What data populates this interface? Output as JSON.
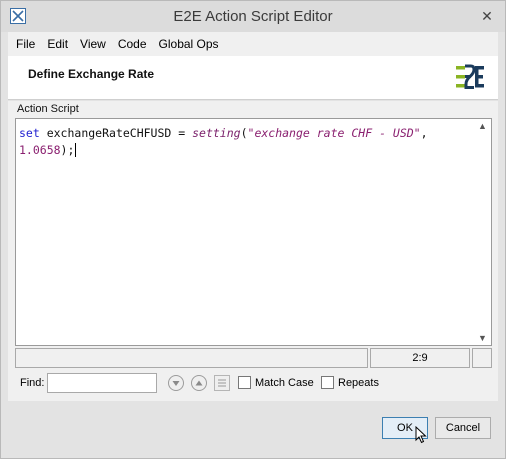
{
  "window": {
    "title": "E2E Action Script Editor"
  },
  "menu": [
    "File",
    "Edit",
    "View",
    "Code",
    "Global Ops"
  ],
  "header": {
    "title": "Define Exchange Rate"
  },
  "editor": {
    "group_label": "Action Script",
    "code": {
      "kw_set": "set",
      "var": " exchangeRateCHFUSD = ",
      "fn": "setting",
      "open": "(",
      "str": "\"exchange rate CHF - USD\"",
      "comma": ",",
      "num": "1.0658",
      "close": ");"
    },
    "cursor_position": "2:9"
  },
  "find": {
    "label": "Find:",
    "value": "",
    "match_case_label": "Match Case",
    "match_case_checked": false,
    "repeats_label": "Repeats",
    "repeats_checked": false
  },
  "buttons": {
    "ok": "OK",
    "cancel": "Cancel"
  },
  "colors": {
    "keyword": "#1f1fd0",
    "string": "#8a1f6f",
    "logo_green": "#8ab423",
    "logo_navy": "#1b3b5c"
  }
}
